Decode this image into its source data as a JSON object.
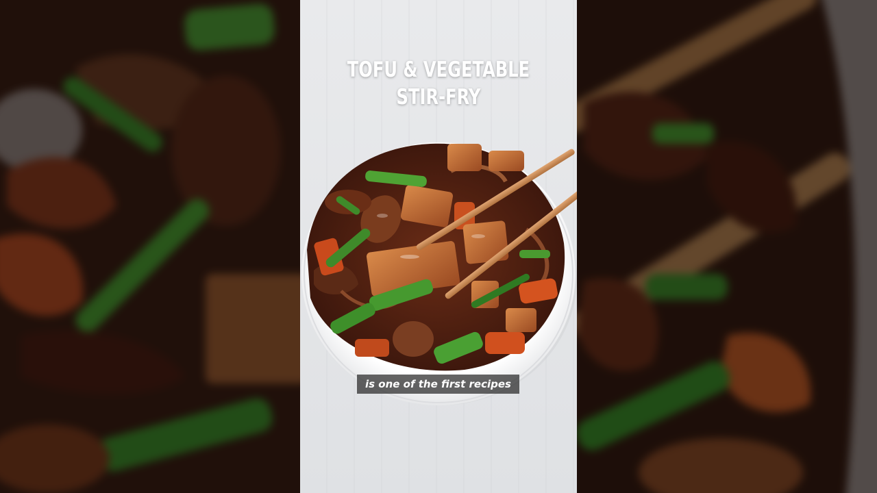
{
  "title": {
    "line1": "TOFU & VEGETABLE",
    "line2": "STIR-FRY"
  },
  "caption": "is one of the first recipes",
  "colors": {
    "tofu": "#c0703a",
    "sauce": "#5a2414",
    "scallion": "#3f8a2a",
    "carrot": "#d4531f",
    "bowl": "#ffffff",
    "chopsticks": "#c98a55"
  }
}
